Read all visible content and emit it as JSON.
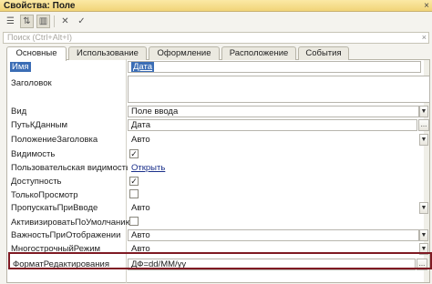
{
  "window": {
    "title": "Свойства: Поле",
    "close": "×"
  },
  "toolbar": {
    "icons": [
      "list-icon",
      "sort-icon",
      "filter-icon",
      "delete-icon",
      "check-icon"
    ],
    "glyphs": [
      "☰",
      "⇅",
      "▥",
      "✕",
      "✓"
    ]
  },
  "search": {
    "placeholder": "Поиск (Ctrl+Alt+I)",
    "clear": "×"
  },
  "tabs": [
    {
      "label": "Основные",
      "active": true
    },
    {
      "label": "Использование",
      "active": false
    },
    {
      "label": "Оформление",
      "active": false
    },
    {
      "label": "Расположение",
      "active": false
    },
    {
      "label": "События",
      "active": false
    }
  ],
  "properties": [
    {
      "label": "Имя",
      "value": "Дата",
      "kind": "text-selected"
    },
    {
      "label": "Заголовок",
      "value": "",
      "kind": "textarea"
    },
    {
      "label": "Вид",
      "value": "Поле ввода",
      "kind": "dropdown"
    },
    {
      "label": "ПутьКДанным",
      "value": "Дата",
      "kind": "dots"
    },
    {
      "label": "ПоложениеЗаголовка",
      "value": "Авто",
      "kind": "dropdown"
    },
    {
      "label": "Видимость",
      "value": "✓",
      "kind": "checkbox"
    },
    {
      "label": "Пользовательская видимость",
      "value": "Открыть",
      "kind": "link"
    },
    {
      "label": "Доступность",
      "value": "✓",
      "kind": "checkbox"
    },
    {
      "label": "ТолькоПросмотр",
      "value": "",
      "kind": "checkbox"
    },
    {
      "label": "ПропускатьПриВводе",
      "value": "Авто",
      "kind": "dropdown"
    },
    {
      "label": "АктивизироватьПоУмолчанию",
      "value": "",
      "kind": "checkbox"
    },
    {
      "label": "ВажностьПриОтображении",
      "value": "Авто",
      "kind": "dropdown"
    },
    {
      "label": "МногострочныйРежим",
      "value": "Авто",
      "kind": "dropdown"
    },
    {
      "label": "ФорматРедактирования",
      "value": "ДФ=dd/MM/yy",
      "kind": "dots"
    }
  ],
  "colors": {
    "accent": "#3b6db5",
    "highlight_frame": "#7f1a23",
    "title_bar": "#f1d478"
  }
}
